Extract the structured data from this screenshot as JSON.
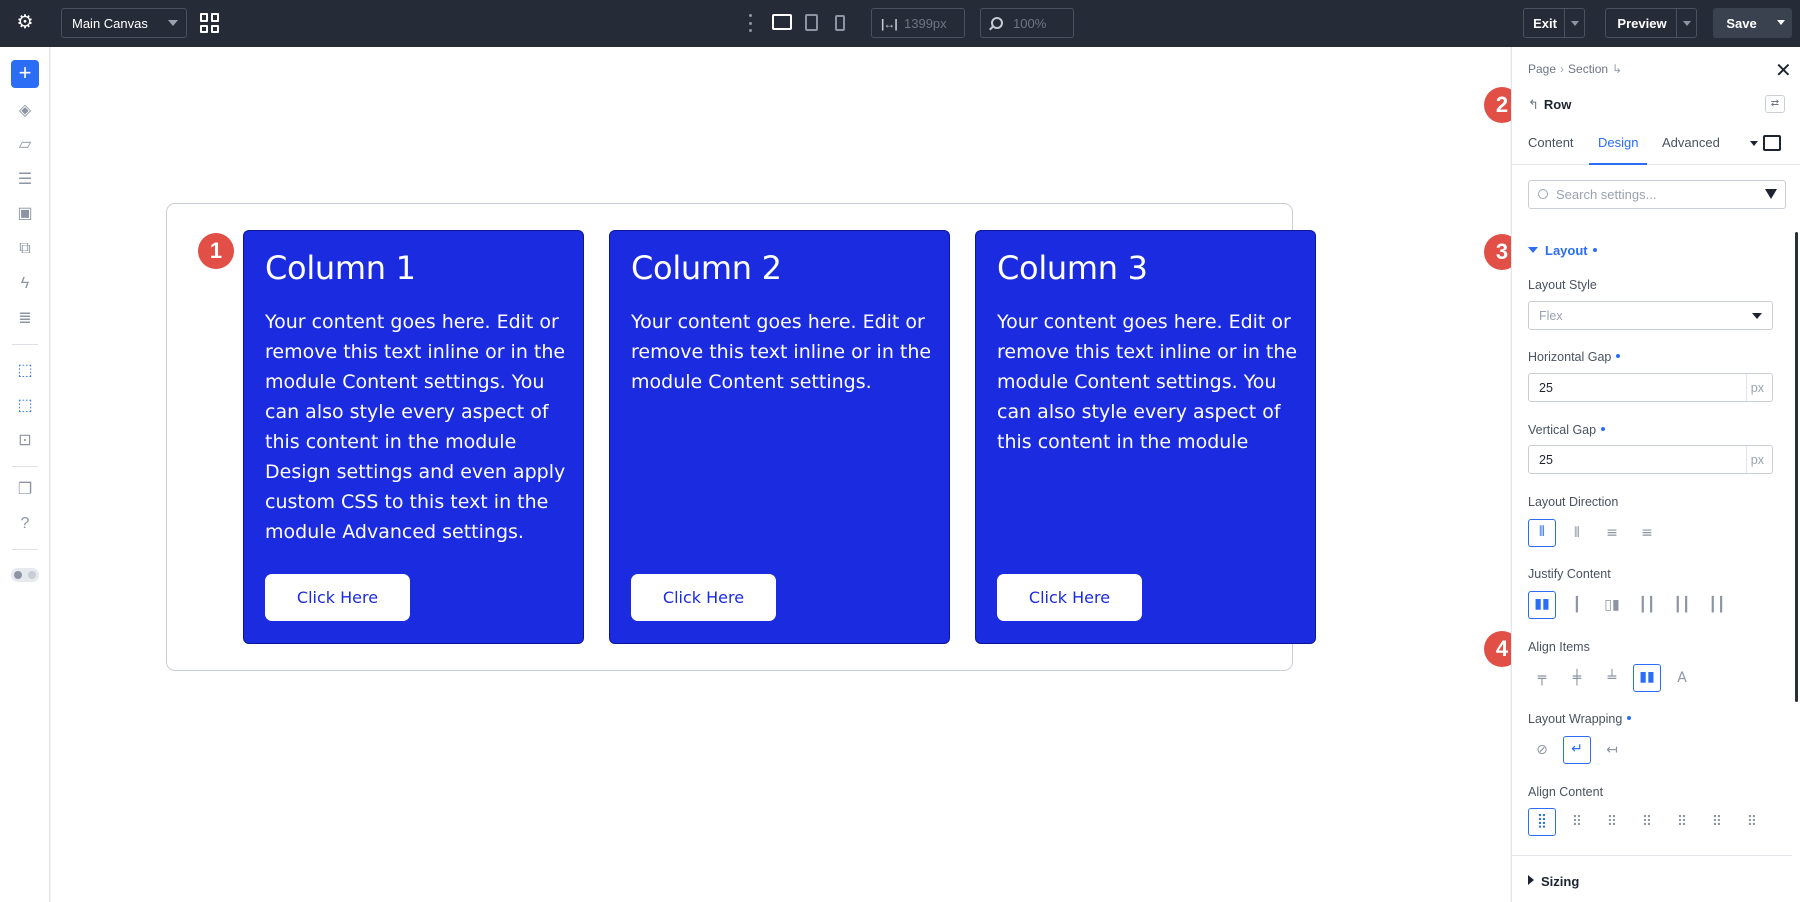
{
  "topbar": {
    "canvas_select": "Main Canvas",
    "width_value": "1399px",
    "zoom_value": "100%",
    "exit_label": "Exit",
    "preview_label": "Preview",
    "save_label": "Save"
  },
  "canvas": {
    "columns": [
      {
        "title": "Column 1",
        "text": "Your content goes here. Edit or remove this text inline or in the module Content settings. You can also style every aspect of this content in the module Design settings and even apply custom CSS to this text in the module Advanced settings.",
        "button": "Click Here"
      },
      {
        "title": "Column 2",
        "text": "Your content goes here. Edit or remove this text inline or in the module Content settings.",
        "button": "Click Here"
      },
      {
        "title": "Column 3",
        "text": "Your content goes here. Edit or remove this text inline or in the module Content settings. You can also style every aspect of this content in the module",
        "button": "Click Here"
      }
    ]
  },
  "badges": [
    "1",
    "2",
    "3",
    "4"
  ],
  "panel": {
    "breadcrumb": [
      "Page",
      "Section"
    ],
    "element_title": "Row",
    "tabs": [
      "Content",
      "Design",
      "Advanced"
    ],
    "active_tab": "Design",
    "search_placeholder": "Search settings...",
    "layout_section": "Layout",
    "layout_style_label": "Layout Style",
    "layout_style_value": "Flex",
    "horizontal_gap_label": "Horizontal Gap",
    "horizontal_gap_value": "25",
    "vertical_gap_label": "Vertical Gap",
    "vertical_gap_value": "25",
    "unit": "px",
    "layout_direction_label": "Layout Direction",
    "justify_content_label": "Justify Content",
    "align_items_label": "Align Items",
    "layout_wrapping_label": "Layout Wrapping",
    "align_content_label": "Align Content",
    "sizing_section": "Sizing"
  },
  "colors": {
    "accent": "#2b6df5",
    "column_bg": "#1a2be0",
    "topbar_bg": "#252c38",
    "badge": "#e14f47"
  }
}
